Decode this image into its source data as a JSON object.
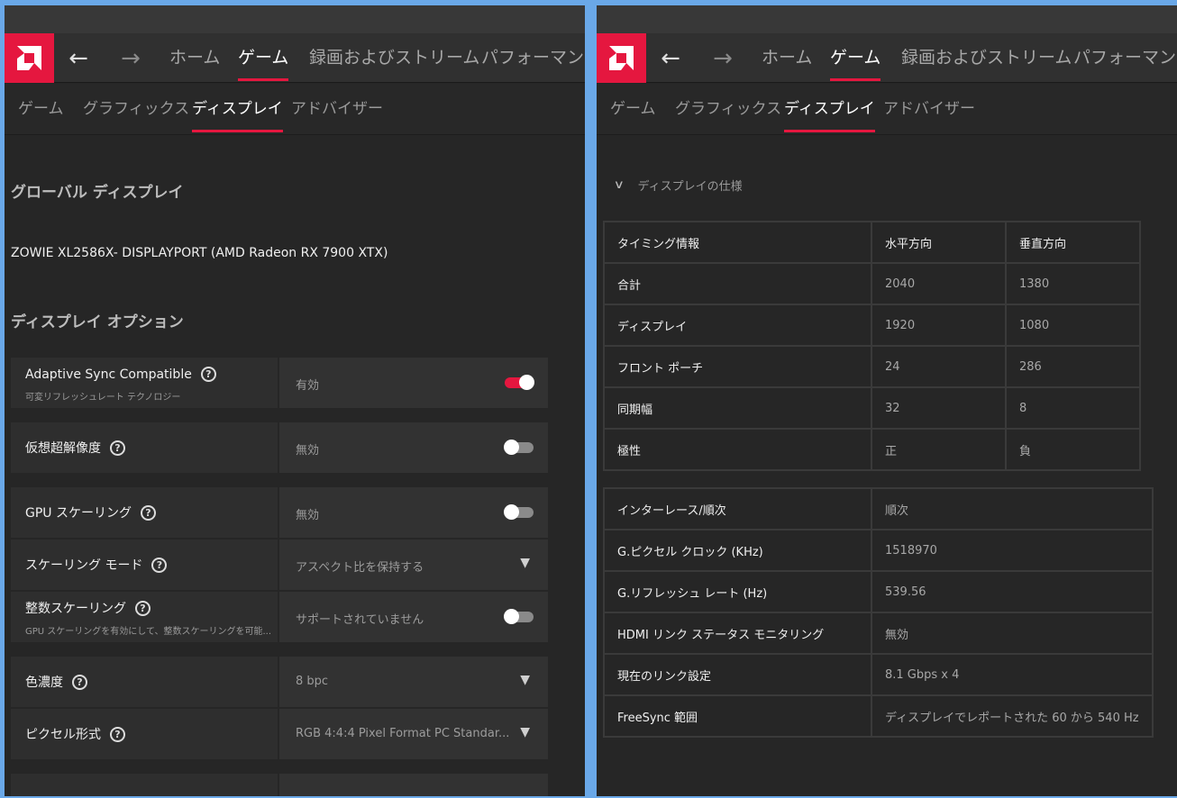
{
  "colors": {
    "accent": "#e5173f",
    "background": "#262626",
    "panel": "#2e2e2e"
  },
  "nav": {
    "back_icon": "arrow-left-icon",
    "forward_icon": "arrow-right-icon",
    "top_tabs": [
      "ホーム",
      "ゲーム",
      "録画およびストリーム",
      "パフォーマンス"
    ],
    "active_top_tab": "ゲーム",
    "sub_tabs": [
      "ゲーム",
      "グラフィックス",
      "ディスプレイ",
      "アドバイザー"
    ],
    "active_sub_tab": "ディスプレイ"
  },
  "left": {
    "section_title": "グローバル ディスプレイ",
    "monitor_name": "ZOWIE XL2586X- DISPLAYPORT (AMD Radeon RX 7900 XTX)",
    "options_title": "ディスプレイ オプション",
    "options": [
      {
        "label": "Adaptive Sync Compatible",
        "desc": "可変リフレッシュレート テクノロジー",
        "value": "有効",
        "control": "toggle",
        "on": true
      },
      {
        "label": "仮想超解像度",
        "desc": "",
        "value": "無効",
        "control": "toggle",
        "on": false
      },
      {
        "label": "GPU スケーリング",
        "desc": "",
        "value": "無効",
        "control": "toggle",
        "on": false
      },
      {
        "label": "スケーリング モード",
        "desc": "",
        "value": "アスペクト比を保持する",
        "control": "dropdown"
      },
      {
        "label": "整数スケーリング",
        "desc": "GPU スケーリングを有効にして、整数スケーリングを可能...",
        "value": "サポートされていません",
        "control": "toggle",
        "on": false
      },
      {
        "label": "色濃度",
        "desc": "",
        "value": "8 bpc",
        "control": "dropdown"
      },
      {
        "label": "ピクセル形式",
        "desc": "",
        "value": "RGB 4:4:4 Pixel Format PC Standar...",
        "control": "dropdown"
      }
    ]
  },
  "right": {
    "spec_header": "ディスプレイの仕様",
    "timing_table": {
      "headers": [
        "タイミング情報",
        "水平方向",
        "垂直方向"
      ],
      "rows": [
        [
          "合計",
          "2040",
          "1380"
        ],
        [
          "ディスプレイ",
          "1920",
          "1080"
        ],
        [
          "フロント ポーチ",
          "24",
          "286"
        ],
        [
          "同期幅",
          "32",
          "8"
        ],
        [
          "極性",
          "正",
          "負"
        ]
      ]
    },
    "info_table": [
      [
        "インターレース/順次",
        "順次"
      ],
      [
        "G.ピクセル クロック (KHz)",
        "1518970"
      ],
      [
        "G.リフレッシュ レート (Hz)",
        "539.56"
      ],
      [
        "HDMI リンク ステータス モニタリング",
        "無効"
      ],
      [
        "現在のリンク設定",
        "8.1 Gbps x 4"
      ],
      [
        "FreeSync 範囲",
        "ディスプレイでレポートされた 60 から 540 Hz"
      ]
    ]
  }
}
